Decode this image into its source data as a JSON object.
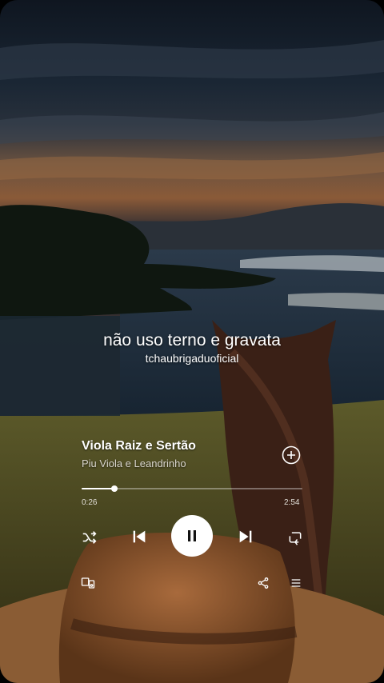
{
  "lyric": {
    "line": "não uso terno e gravata",
    "handle": "tchaubrigaduoficial"
  },
  "track": {
    "title": "Viola Raiz e Sertão",
    "artist": "Piu Viola e Leandrinho"
  },
  "playback": {
    "elapsed": "0:26",
    "duration": "2:54",
    "progress": 0.149
  },
  "icons": {
    "add": "add-circle-icon",
    "shuffle": "shuffle-icon",
    "previous": "skip-previous-icon",
    "pause": "pause-icon",
    "next": "skip-next-icon",
    "repeat": "repeat-icon",
    "devices": "connect-device-icon",
    "share": "share-icon",
    "queue": "queue-icon"
  },
  "colors": {
    "foreground": "#ffffff",
    "subtext": "#d8d4cc",
    "track_bg": "rgba(255,255,255,0.35)"
  }
}
